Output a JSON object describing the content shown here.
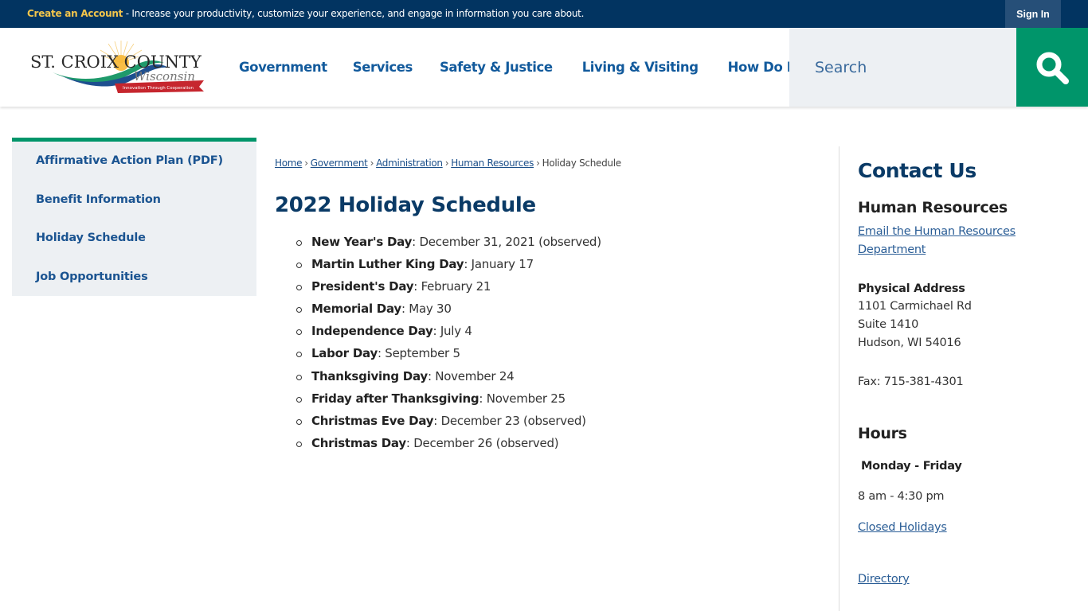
{
  "topbar": {
    "create_account_label": "Create an Account",
    "promo_text": " - Increase your productivity, customize your experience, and engage in information you care about.",
    "sign_in_label": "Sign In"
  },
  "header": {
    "logo": {
      "name_line": "ST. CROIX COUNTY",
      "script_line": "Wisconsin",
      "tagline": "Innovation Through Cooperation"
    },
    "nav": [
      {
        "label": "Government"
      },
      {
        "label": "Services"
      },
      {
        "label": "Safety & Justice"
      },
      {
        "label": "Living & Visiting"
      },
      {
        "label": "How Do I..."
      }
    ],
    "search": {
      "placeholder": "Search",
      "value": ""
    }
  },
  "sidenav": {
    "items": [
      {
        "label": "Affirmative Action Plan (PDF)"
      },
      {
        "label": "Benefit Information"
      },
      {
        "label": "Holiday Schedule"
      },
      {
        "label": "Job Opportunities"
      }
    ]
  },
  "breadcrumb": {
    "links": [
      "Home",
      "Government",
      "Administration",
      "Human Resources"
    ],
    "current": "Holiday Schedule",
    "separator": "›"
  },
  "main": {
    "title": "2022 Holiday Schedule",
    "holidays": [
      {
        "name": "New Year's Day",
        "date": ": December 31, 2021 (observed)"
      },
      {
        "name": "Martin Luther King Day",
        "date": ": January 17"
      },
      {
        "name": "President's Day",
        "date": ": February 21"
      },
      {
        "name": "Memorial Day",
        "date": ": May 30"
      },
      {
        "name": "Independence Day",
        "date": ": July 4"
      },
      {
        "name": "Labor Day",
        "date": ": September 5"
      },
      {
        "name": "Thanksgiving Day",
        "date": ": November 24"
      },
      {
        "name": "Friday after Thanksgiving",
        "date": ": November 25"
      },
      {
        "name": "Christmas Eve Day",
        "date": ": December 23 (observed)"
      },
      {
        "name": "Christmas Day",
        "date": ": December 26 (observed)"
      }
    ]
  },
  "contact": {
    "title": "Contact Us",
    "department": "Human Resources",
    "email_link_line1": "Email the Human Resources",
    "email_link_line2": "Department",
    "address_label": "Physical Address",
    "address_lines": [
      "1101 Carmichael Rd",
      "Suite 1410",
      "Hudson, WI 54016"
    ],
    "fax": "Fax: 715-381-4301",
    "hours_title": "Hours",
    "hours_days": "Monday - Friday",
    "hours_time": "8 am - 4:30 pm",
    "closed_holidays_link": "Closed Holidays",
    "directory_link": "Directory"
  },
  "colors": {
    "topbar_bg": "#023461",
    "accent_green": "#00956a",
    "nav_blue": "#125a9c",
    "title_navy": "#0a3a66",
    "create_account_gold": "#f3c54b"
  }
}
